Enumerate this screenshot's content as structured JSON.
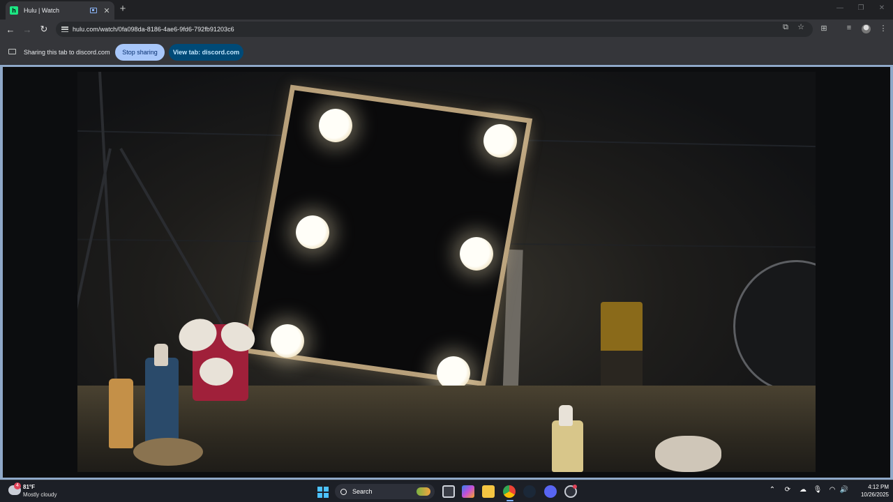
{
  "browser": {
    "tab": {
      "title": "Hulu | Watch",
      "favicon_letter": "h"
    },
    "new_tab_symbol": "+",
    "url": "hulu.com/watch/0fa098da-8186-4ae6-9fd6-792fb91203c6"
  },
  "infobar": {
    "message": "Sharing this tab to discord.com",
    "stop_button": "Stop sharing",
    "view_button": "View tab: discord.com"
  },
  "video": {
    "scene": "vanity-mirror-with-bulbs"
  },
  "taskbar": {
    "weather": {
      "temp": "81°F",
      "condition": "Mostly cloudy",
      "badge": "4"
    },
    "search_label": "Search",
    "clock": {
      "time": "4:12 PM",
      "date": "10/26/2025"
    }
  },
  "colors": {
    "accent": "#a8c7fa",
    "view_button_bg": "#004a77",
    "hulu_green": "#1ce783",
    "border_share": "#8fa8c8"
  }
}
